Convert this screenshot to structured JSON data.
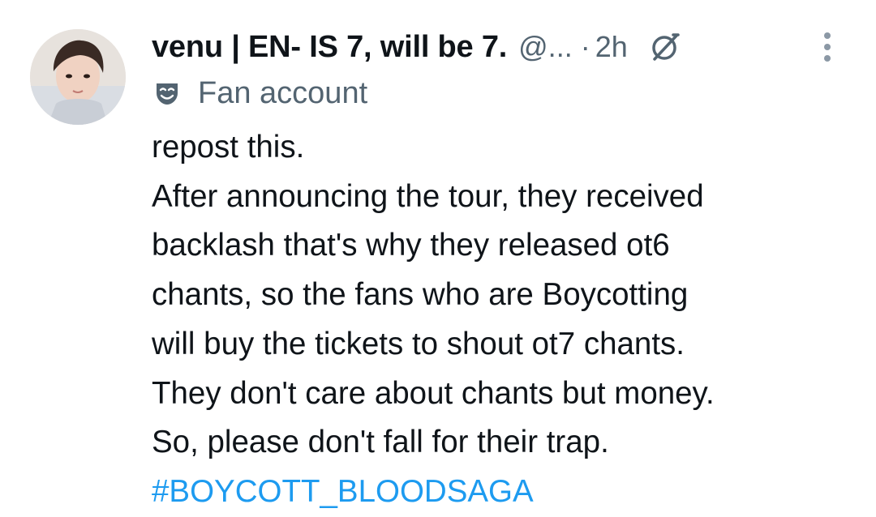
{
  "author": {
    "display_name": "venu | EN- IS 7, will be 7.",
    "handle": "@...",
    "separator": "·",
    "time": "2h",
    "account_label": "Fan account"
  },
  "icons": {
    "grok": "grok-icon",
    "more": "more-vertical-icon",
    "label": "mask-icon",
    "avatar": "avatar"
  },
  "tweet": {
    "lines": [
      "repost this.",
      "After announcing the tour, they received",
      "backlash that's why they released ot6",
      "chants, so the fans who are Boycotting",
      "will buy the tickets to shout ot7 chants.",
      "They don't care about chants but money.",
      "So, please don't fall for their trap."
    ],
    "hashtag": "#BOYCOTT_BLOODSAGA"
  },
  "colors": {
    "text": "#0f1419",
    "secondary": "#536471",
    "link": "#1d9bf0"
  }
}
